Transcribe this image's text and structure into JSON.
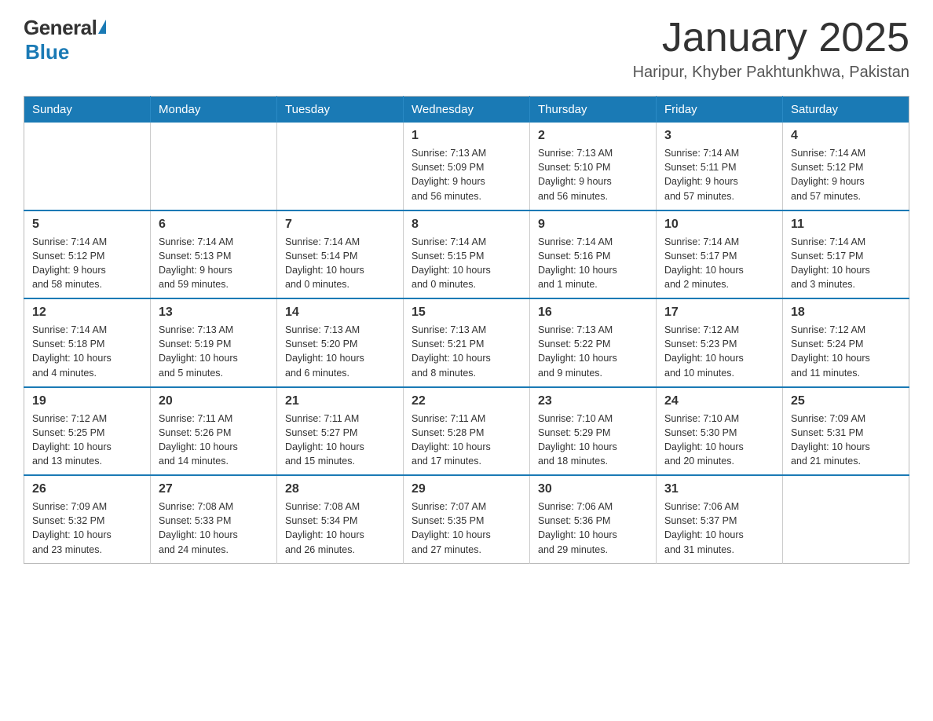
{
  "logo": {
    "general": "General",
    "blue": "Blue"
  },
  "title": "January 2025",
  "subtitle": "Haripur, Khyber Pakhtunkhwa, Pakistan",
  "days_of_week": [
    "Sunday",
    "Monday",
    "Tuesday",
    "Wednesday",
    "Thursday",
    "Friday",
    "Saturday"
  ],
  "weeks": [
    [
      {
        "day": "",
        "info": ""
      },
      {
        "day": "",
        "info": ""
      },
      {
        "day": "",
        "info": ""
      },
      {
        "day": "1",
        "info": "Sunrise: 7:13 AM\nSunset: 5:09 PM\nDaylight: 9 hours\nand 56 minutes."
      },
      {
        "day": "2",
        "info": "Sunrise: 7:13 AM\nSunset: 5:10 PM\nDaylight: 9 hours\nand 56 minutes."
      },
      {
        "day": "3",
        "info": "Sunrise: 7:14 AM\nSunset: 5:11 PM\nDaylight: 9 hours\nand 57 minutes."
      },
      {
        "day": "4",
        "info": "Sunrise: 7:14 AM\nSunset: 5:12 PM\nDaylight: 9 hours\nand 57 minutes."
      }
    ],
    [
      {
        "day": "5",
        "info": "Sunrise: 7:14 AM\nSunset: 5:12 PM\nDaylight: 9 hours\nand 58 minutes."
      },
      {
        "day": "6",
        "info": "Sunrise: 7:14 AM\nSunset: 5:13 PM\nDaylight: 9 hours\nand 59 minutes."
      },
      {
        "day": "7",
        "info": "Sunrise: 7:14 AM\nSunset: 5:14 PM\nDaylight: 10 hours\nand 0 minutes."
      },
      {
        "day": "8",
        "info": "Sunrise: 7:14 AM\nSunset: 5:15 PM\nDaylight: 10 hours\nand 0 minutes."
      },
      {
        "day": "9",
        "info": "Sunrise: 7:14 AM\nSunset: 5:16 PM\nDaylight: 10 hours\nand 1 minute."
      },
      {
        "day": "10",
        "info": "Sunrise: 7:14 AM\nSunset: 5:17 PM\nDaylight: 10 hours\nand 2 minutes."
      },
      {
        "day": "11",
        "info": "Sunrise: 7:14 AM\nSunset: 5:17 PM\nDaylight: 10 hours\nand 3 minutes."
      }
    ],
    [
      {
        "day": "12",
        "info": "Sunrise: 7:14 AM\nSunset: 5:18 PM\nDaylight: 10 hours\nand 4 minutes."
      },
      {
        "day": "13",
        "info": "Sunrise: 7:13 AM\nSunset: 5:19 PM\nDaylight: 10 hours\nand 5 minutes."
      },
      {
        "day": "14",
        "info": "Sunrise: 7:13 AM\nSunset: 5:20 PM\nDaylight: 10 hours\nand 6 minutes."
      },
      {
        "day": "15",
        "info": "Sunrise: 7:13 AM\nSunset: 5:21 PM\nDaylight: 10 hours\nand 8 minutes."
      },
      {
        "day": "16",
        "info": "Sunrise: 7:13 AM\nSunset: 5:22 PM\nDaylight: 10 hours\nand 9 minutes."
      },
      {
        "day": "17",
        "info": "Sunrise: 7:12 AM\nSunset: 5:23 PM\nDaylight: 10 hours\nand 10 minutes."
      },
      {
        "day": "18",
        "info": "Sunrise: 7:12 AM\nSunset: 5:24 PM\nDaylight: 10 hours\nand 11 minutes."
      }
    ],
    [
      {
        "day": "19",
        "info": "Sunrise: 7:12 AM\nSunset: 5:25 PM\nDaylight: 10 hours\nand 13 minutes."
      },
      {
        "day": "20",
        "info": "Sunrise: 7:11 AM\nSunset: 5:26 PM\nDaylight: 10 hours\nand 14 minutes."
      },
      {
        "day": "21",
        "info": "Sunrise: 7:11 AM\nSunset: 5:27 PM\nDaylight: 10 hours\nand 15 minutes."
      },
      {
        "day": "22",
        "info": "Sunrise: 7:11 AM\nSunset: 5:28 PM\nDaylight: 10 hours\nand 17 minutes."
      },
      {
        "day": "23",
        "info": "Sunrise: 7:10 AM\nSunset: 5:29 PM\nDaylight: 10 hours\nand 18 minutes."
      },
      {
        "day": "24",
        "info": "Sunrise: 7:10 AM\nSunset: 5:30 PM\nDaylight: 10 hours\nand 20 minutes."
      },
      {
        "day": "25",
        "info": "Sunrise: 7:09 AM\nSunset: 5:31 PM\nDaylight: 10 hours\nand 21 minutes."
      }
    ],
    [
      {
        "day": "26",
        "info": "Sunrise: 7:09 AM\nSunset: 5:32 PM\nDaylight: 10 hours\nand 23 minutes."
      },
      {
        "day": "27",
        "info": "Sunrise: 7:08 AM\nSunset: 5:33 PM\nDaylight: 10 hours\nand 24 minutes."
      },
      {
        "day": "28",
        "info": "Sunrise: 7:08 AM\nSunset: 5:34 PM\nDaylight: 10 hours\nand 26 minutes."
      },
      {
        "day": "29",
        "info": "Sunrise: 7:07 AM\nSunset: 5:35 PM\nDaylight: 10 hours\nand 27 minutes."
      },
      {
        "day": "30",
        "info": "Sunrise: 7:06 AM\nSunset: 5:36 PM\nDaylight: 10 hours\nand 29 minutes."
      },
      {
        "day": "31",
        "info": "Sunrise: 7:06 AM\nSunset: 5:37 PM\nDaylight: 10 hours\nand 31 minutes."
      },
      {
        "day": "",
        "info": ""
      }
    ]
  ]
}
